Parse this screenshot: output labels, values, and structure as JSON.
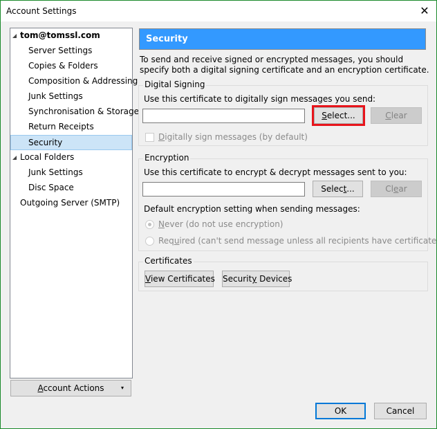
{
  "window": {
    "title": "Account Settings",
    "close_label": "✕"
  },
  "tree": {
    "items": [
      {
        "label": "tom@tomssl.com",
        "level": 0,
        "expanded": true,
        "bold": true
      },
      {
        "label": "Server Settings",
        "level": 1
      },
      {
        "label": "Copies & Folders",
        "level": 1
      },
      {
        "label": "Composition & Addressing",
        "level": 1
      },
      {
        "label": "Junk Settings",
        "level": 1
      },
      {
        "label": "Synchronisation & Storage",
        "level": 1
      },
      {
        "label": "Return Receipts",
        "level": 1
      },
      {
        "label": "Security",
        "level": 1,
        "selected": true
      },
      {
        "label": "Local Folders",
        "level": 0,
        "expanded": true
      },
      {
        "label": "Junk Settings",
        "level": 1
      },
      {
        "label": "Disc Space",
        "level": 1
      },
      {
        "label": "Outgoing Server (SMTP)",
        "level": 0
      }
    ]
  },
  "account_actions": {
    "label_accel": "A",
    "label_rest": "ccount Actions",
    "dropdown_glyph": "▾"
  },
  "page": {
    "title": "Security",
    "intro": "To send and receive signed or encrypted messages, you should specify both a digital signing certificate and an encryption certificate.",
    "colors": {
      "header_bg": "#3399ff",
      "highlight_box": "#e8141b",
      "default_button_border": "#0078d7"
    }
  },
  "signing": {
    "legend": "Digital Signing",
    "prompt": "Use this certificate to digitally sign messages you send:",
    "cert_value": "",
    "select_accel": "S",
    "select_rest": "elect...",
    "clear_accel": "C",
    "clear_rest": "lear",
    "checkbox_accel": "D",
    "checkbox_rest": "igitally sign messages (by default)",
    "checkbox_checked": false
  },
  "encryption": {
    "legend": "Encryption",
    "prompt": "Use this certificate to encrypt & decrypt messages sent to you:",
    "cert_value": "",
    "select_pre": "Selec",
    "select_accel": "t",
    "select_rest": "...",
    "clear_pre": "Cl",
    "clear_accel": "e",
    "clear_rest": "ar",
    "default_label": "Default encryption setting when sending messages:",
    "radio_never_accel": "N",
    "radio_never_rest": "ever (do not use encryption)",
    "radio_required_pre": "Req",
    "radio_required_accel": "u",
    "radio_required_rest": "ired (can't send message unless all recipients have certificates)",
    "selected": "never"
  },
  "certificates": {
    "legend": "Certificates",
    "view_accel": "V",
    "view_rest": "iew Certificates",
    "devices_pre": "Securit",
    "devices_accel": "y",
    "devices_rest": " Devices"
  },
  "footer": {
    "ok_label": "OK",
    "cancel_label": "Cancel"
  }
}
